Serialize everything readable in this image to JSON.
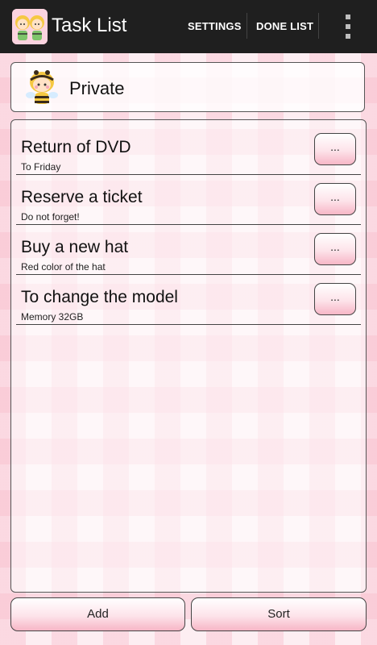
{
  "app": {
    "title": "Task List"
  },
  "actionbar": {
    "settings_label": "SETTINGS",
    "done_list_label": "DONE LIST"
  },
  "header": {
    "label": "Private"
  },
  "tasks": [
    {
      "title": "Return of DVD",
      "subtitle": "To Friday",
      "menu_label": "..."
    },
    {
      "title": "Reserve a ticket",
      "subtitle": "Do not forget!",
      "menu_label": "..."
    },
    {
      "title": "Buy a new hat",
      "subtitle": "Red color of the hat",
      "menu_label": "..."
    },
    {
      "title": "To change the model",
      "subtitle": "Memory 32GB",
      "menu_label": "..."
    }
  ],
  "bottom": {
    "add_label": "Add",
    "sort_label": "Sort"
  },
  "colors": {
    "actionbar": "#1f1f1f",
    "background": "#fdeef2",
    "check": "#f8bece",
    "button_gradient_bottom": "#f7b6c6"
  },
  "icons": {
    "app": "bee-girls-app-icon",
    "header": "bee-character-icon",
    "overflow": "overflow-menu-icon"
  }
}
